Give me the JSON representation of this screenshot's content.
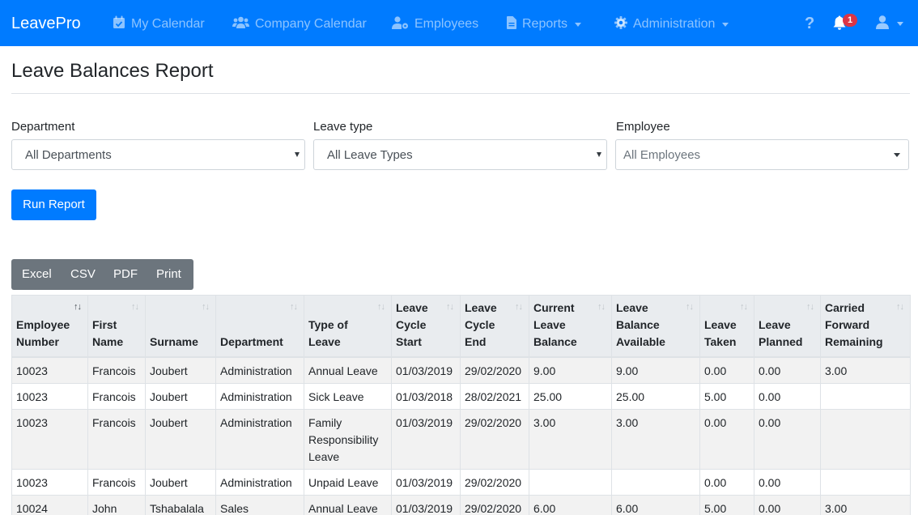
{
  "app": {
    "brand": "LeavePro"
  },
  "nav": {
    "items": [
      {
        "label": "My Calendar",
        "icon": "calendar-check-icon"
      },
      {
        "label": "Company Calendar",
        "icon": "users-icon"
      },
      {
        "label": "Employees",
        "icon": "user-cog-icon"
      },
      {
        "label": "Reports",
        "icon": "file-icon",
        "dropdown": true
      },
      {
        "label": "Administration",
        "icon": "gear-icon",
        "dropdown": true
      }
    ],
    "help_icon": "question-icon",
    "notifications": {
      "icon": "bell-icon",
      "count": "1"
    },
    "user_icon": "user-icon"
  },
  "page": {
    "title": "Leave Balances Report"
  },
  "filters": {
    "department": {
      "label": "Department",
      "value": "All Departments"
    },
    "leave_type": {
      "label": "Leave type",
      "value": "All Leave Types"
    },
    "employee": {
      "label": "Employee",
      "value": "All Employees"
    }
  },
  "actions": {
    "run_report": "Run Report"
  },
  "export": {
    "excel": "Excel",
    "csv": "CSV",
    "pdf": "PDF",
    "print": "Print"
  },
  "table": {
    "headers": [
      {
        "lines": [
          "Employee",
          "Number"
        ]
      },
      {
        "lines": [
          "First",
          "Name"
        ]
      },
      {
        "lines": [
          "Surname"
        ]
      },
      {
        "lines": [
          "Department"
        ]
      },
      {
        "lines": [
          "Type of",
          "Leave"
        ]
      },
      {
        "lines": [
          "Leave",
          "Cycle",
          "Start"
        ]
      },
      {
        "lines": [
          "Leave",
          "Cycle",
          "End"
        ]
      },
      {
        "lines": [
          "Current",
          "Leave",
          "Balance"
        ]
      },
      {
        "lines": [
          "Leave",
          "Balance",
          "Available"
        ]
      },
      {
        "lines": [
          "Leave",
          "Taken"
        ]
      },
      {
        "lines": [
          "Leave",
          "Planned"
        ]
      },
      {
        "lines": [
          "Carried",
          "Forward",
          "Remaining"
        ]
      }
    ],
    "rows": [
      [
        "10023",
        "Francois",
        "Joubert",
        "Administration",
        "Annual Leave",
        "01/03/2019",
        "29/02/2020",
        "9.00",
        "9.00",
        "0.00",
        "0.00",
        "3.00"
      ],
      [
        "10023",
        "Francois",
        "Joubert",
        "Administration",
        "Sick Leave",
        "01/03/2018",
        "28/02/2021",
        "25.00",
        "25.00",
        "5.00",
        "0.00",
        ""
      ],
      [
        "10023",
        "Francois",
        "Joubert",
        "Administration",
        "Family Responsibility Leave",
        "01/03/2019",
        "29/02/2020",
        "3.00",
        "3.00",
        "0.00",
        "0.00",
        ""
      ],
      [
        "10023",
        "Francois",
        "Joubert",
        "Administration",
        "Unpaid Leave",
        "01/03/2019",
        "29/02/2020",
        "",
        "",
        "0.00",
        "0.00",
        ""
      ],
      [
        "10024",
        "John",
        "Tshabalala",
        "Sales",
        "Annual Leave",
        "01/03/2019",
        "29/02/2020",
        "6.00",
        "6.00",
        "5.00",
        "0.00",
        "3.00"
      ]
    ]
  },
  "colors": {
    "primary": "#007bff",
    "secondary": "#6c757d",
    "danger": "#dc3545",
    "table_header": "#e9ecef",
    "table_stripe": "#f2f2f2"
  }
}
